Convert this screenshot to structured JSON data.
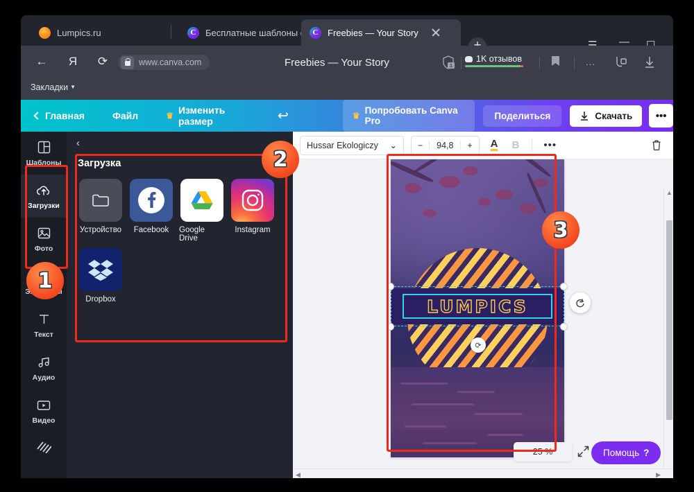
{
  "browser": {
    "tabs": [
      {
        "title": "Lumpics.ru",
        "favicon": "orange-circle-icon",
        "active": false,
        "closable": false
      },
      {
        "title": "Бесплатные шаблоны стор",
        "favicon": "canva-icon",
        "active": false,
        "closable": false
      },
      {
        "title": "Freebies — Your Story",
        "favicon": "canva-icon",
        "active": true,
        "closable": true
      }
    ],
    "new_tab_label": "+",
    "window_controls": {
      "menu": "☰",
      "minimize": "—",
      "maximize": "☐",
      "close": "✕"
    },
    "nav": {
      "back": "←",
      "yandex": "Я",
      "reload": "⟳"
    },
    "address": {
      "url": "www.canva.com",
      "lock": "lock-icon"
    },
    "page_title": "Freebies — Your Story",
    "toolbar_right": {
      "shield_badge": "1",
      "reviews_label": "1K отзывов",
      "bookmark": "bookmark-icon",
      "more": "...",
      "collections": "collections-icon",
      "downloads": "download-icon"
    },
    "bookmarks_label": "Закладки",
    "bookmarks_caret": "▼"
  },
  "canva": {
    "topbar": {
      "back_label": "Главная",
      "file_label": "Файл",
      "resize_label": "Изменить размер",
      "resize_crown": "♛",
      "undo": "↩",
      "pro_label": "Попробовать Canva Pro",
      "pro_crown": "♛",
      "share_label": "Поделиться",
      "download_label": "Скачать",
      "more_label": "•••"
    },
    "rail": [
      {
        "label": "Шаблоны",
        "icon": "templates-icon",
        "selected": false
      },
      {
        "label": "Загрузки",
        "icon": "upload-cloud-icon",
        "selected": true
      },
      {
        "label": "Фото",
        "icon": "photo-icon",
        "selected": false
      },
      {
        "label": "Элементы",
        "icon": "elements-icon",
        "selected": false
      },
      {
        "label": "Текст",
        "icon": "text-icon",
        "selected": false
      },
      {
        "label": "Аудио",
        "icon": "audio-icon",
        "selected": false
      },
      {
        "label": "Видео",
        "icon": "video-icon",
        "selected": false
      },
      {
        "label": "",
        "icon": "background-icon",
        "selected": false
      }
    ],
    "panel": {
      "back_chevron": "‹",
      "heading": "Загрузка",
      "sources": [
        {
          "label": "Устройство",
          "icon": "folder-icon"
        },
        {
          "label": "Facebook",
          "icon": "facebook-icon"
        },
        {
          "label": "Google Drive",
          "icon": "google-drive-icon"
        },
        {
          "label": "Instagram",
          "icon": "instagram-icon"
        },
        {
          "label": "Dropbox",
          "icon": "dropbox-icon"
        }
      ],
      "collapse_chevron": "‹"
    },
    "editor_toolbar": {
      "font_name": "Hussar Ekologiczy",
      "font_caret": "⌄",
      "size_minus": "−",
      "size_value": "94,8",
      "size_plus": "+",
      "text_color_label": "A",
      "bold_label": "B",
      "more_label": "•••",
      "delete_icon": "trash-icon"
    },
    "canvas": {
      "design_text": "LUMPICS",
      "zoom_label": "25 %",
      "expand_icon": "expand-icon",
      "rotate_icon": "rotate-icon",
      "flip_icon": "flip-icon"
    },
    "help_label": "Помощь",
    "help_mark": "?"
  },
  "annotations": [
    {
      "number": "1",
      "target": "rail-uploads-photos"
    },
    {
      "number": "2",
      "target": "upload-panel"
    },
    {
      "number": "3",
      "target": "design-canvas"
    }
  ],
  "colors": {
    "accent_purple": "#7b2cf0",
    "accent_cyan": "#00c4cc",
    "annotation_red": "#ee2b1b",
    "annotation_orange": "#f4491f"
  }
}
